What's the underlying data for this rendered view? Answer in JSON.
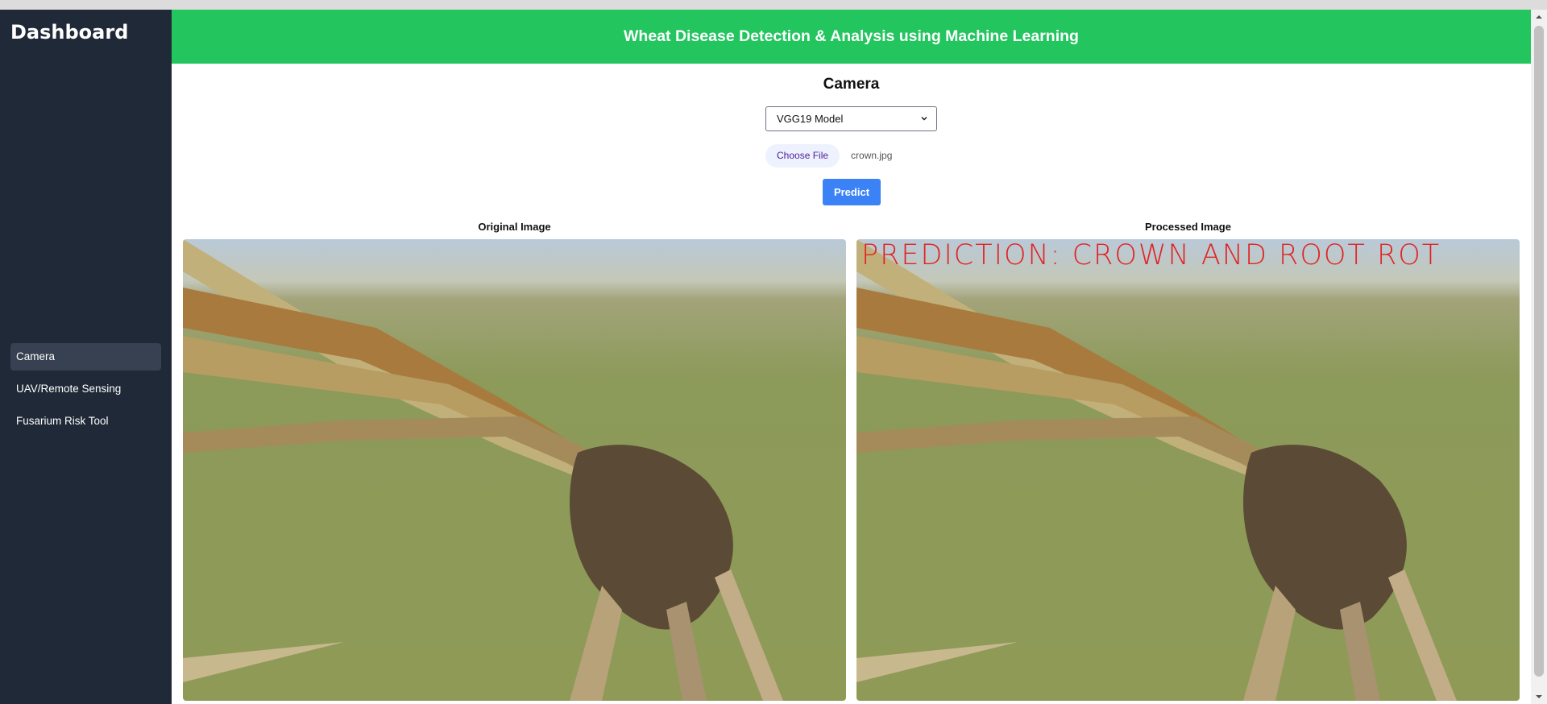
{
  "sidebar": {
    "brand": "Dashboard",
    "items": [
      {
        "label": "Camera",
        "active": true
      },
      {
        "label": "UAV/Remote Sensing",
        "active": false
      },
      {
        "label": "Fusarium Risk Tool",
        "active": false
      }
    ]
  },
  "header": {
    "title": "Wheat Disease Detection & Analysis using Machine Learning"
  },
  "main": {
    "title": "Camera",
    "model_select": {
      "value": "VGG19 Model"
    },
    "file": {
      "button_label": "Choose File",
      "file_name": "crown.jpg"
    },
    "predict_label": "Predict",
    "original_label": "Original Image",
    "processed_label": "Processed Image",
    "prediction_overlay": "PREDICTION: CROWN AND ROOT ROT"
  },
  "icons": {
    "select": "chevron-down-icon"
  },
  "colors": {
    "sidebar": "#1f2937",
    "header": "#22c55e",
    "predict": "#3b82f6",
    "overlay": "#e02424"
  }
}
